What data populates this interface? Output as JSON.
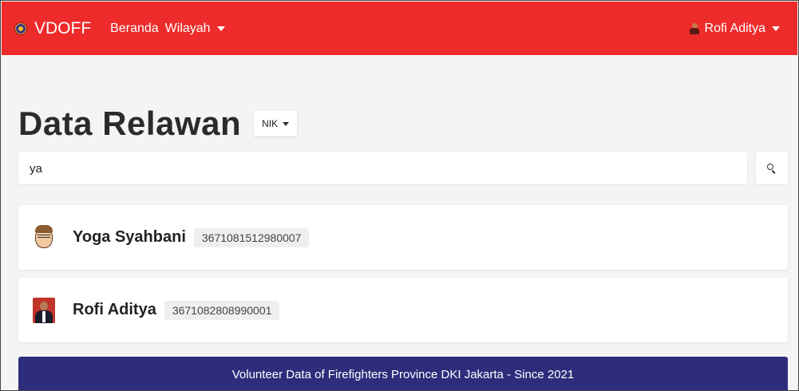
{
  "navbar": {
    "brand": "VDOFF",
    "links": [
      {
        "label": "Beranda"
      },
      {
        "label": "Wilayah"
      }
    ],
    "user": "Rofi Aditya"
  },
  "page": {
    "title": "Data Relawan",
    "filter_label": "NIK"
  },
  "search": {
    "value": "ya"
  },
  "results": [
    {
      "name": "Yoga Syahbani",
      "nik": "3671081512980007",
      "avatar": "cartoon-avatar"
    },
    {
      "name": "Rofi Aditya",
      "nik": "3671082808990001",
      "avatar": "photo-avatar"
    }
  ],
  "footer": {
    "text": "Volunteer Data of Firefighters Province DKI Jakarta - Since 2021"
  },
  "colors": {
    "navbar": "#ee2b2b",
    "footer": "#2e2d7c",
    "background": "#f4f4f4"
  }
}
